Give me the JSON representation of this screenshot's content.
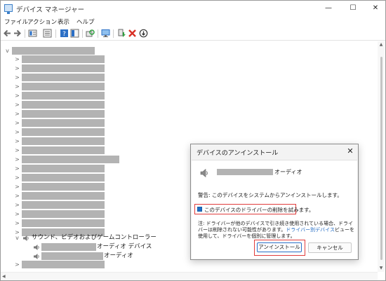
{
  "window": {
    "title": "デバイス マネージャー",
    "controls": {
      "minimize": "—",
      "maximize": "☐",
      "close": "✕"
    }
  },
  "menu": [
    "ファイル",
    "アクション",
    "表示",
    "ヘルプ"
  ],
  "toolbar": {
    "icons": [
      "back-arrow-icon",
      "forward-arrow-icon",
      "properties-icon",
      "list-view-icon",
      "help-icon",
      "panel-icon",
      "scan-hardware-icon",
      "monitor-icon",
      "update-driver-icon",
      "uninstall-icon",
      "disable-device-icon"
    ],
    "colors": {
      "blue": "#2b6fc6",
      "red": "#d93025",
      "green": "#2e9e3e"
    }
  },
  "tree": {
    "root_chevron": "v",
    "collapsed_chevron": ">",
    "expanded_chevron": "v",
    "sound_category_label": "サウンド、ビデオおよびゲームコントローラー",
    "sound_children": [
      {
        "label": "オーディオ デバイス",
        "icon": "speaker-icon"
      },
      {
        "label": "オーディオ",
        "icon": "speaker-icon"
      }
    ]
  },
  "dialog": {
    "title": "デバイスのアンインストール",
    "close": "✕",
    "device_name_suffix": "オーディオ",
    "device_icon": "speaker-icon",
    "warning": "警告: このデバイスをシステムからアンインストールします。",
    "checkbox_label": "このデバイスのドライバーの削除を試みます。",
    "checkbox_checked": true,
    "note_line1": "注: ドライバーが他のデバイスで引き続き使用されている場合、ドライ",
    "note_line2_pre": "バーは削除されない可能性があります。",
    "note_link": "ドライバー別デバイス",
    "note_line2_post": "ビューを",
    "note_line3": "使用して、ドライバーを個別に管理します。",
    "uninstall_button": "アンインストール",
    "cancel_button": "キャンセル",
    "highlight_color": "#e03c3c"
  }
}
